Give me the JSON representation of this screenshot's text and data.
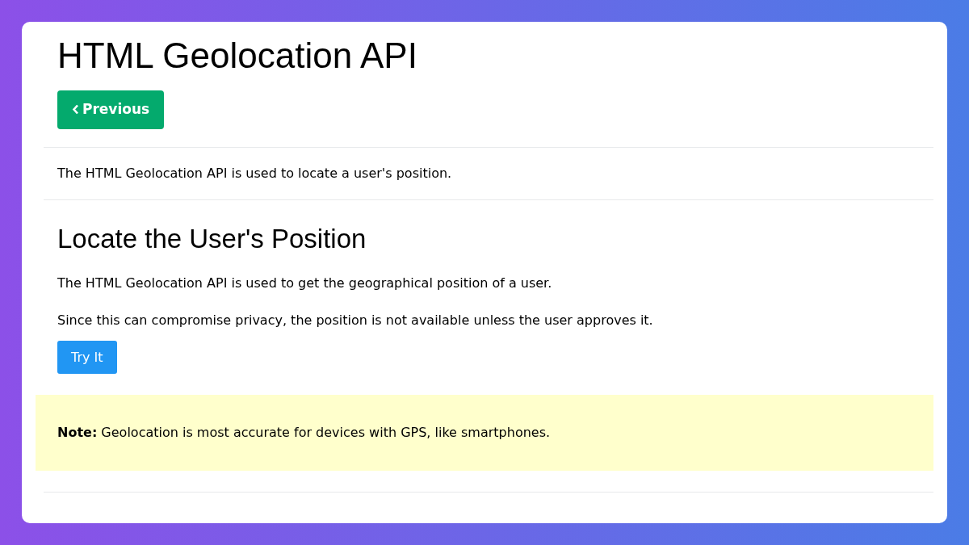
{
  "title": "HTML Geolocation API",
  "previous_button": {
    "label": "Previous"
  },
  "intro": "The HTML Geolocation API is used to locate a user's position.",
  "section": {
    "heading": "Locate the User's Position",
    "paragraphs": [
      "The HTML Geolocation API is used to get the geographical position of a user.",
      "Since this can compromise privacy, the position is not available unless the user approves it."
    ],
    "try_button": {
      "label": "Try It"
    }
  },
  "note": "**Note:** Geolocation is most accurate for devices with GPS, like smartphones."
}
